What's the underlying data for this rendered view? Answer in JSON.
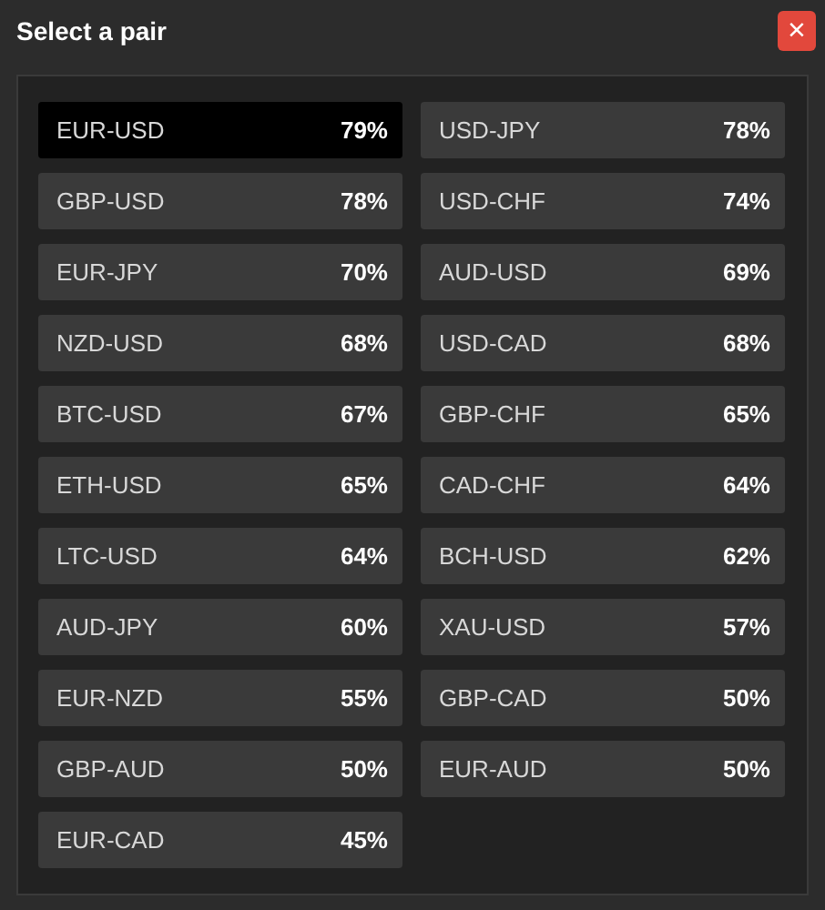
{
  "dialog": {
    "title": "Select a pair",
    "close": "×"
  },
  "pairs": [
    {
      "name": "EUR-USD",
      "payout": "79%",
      "selected": true
    },
    {
      "name": "USD-JPY",
      "payout": "78%",
      "selected": false
    },
    {
      "name": "GBP-USD",
      "payout": "78%",
      "selected": false
    },
    {
      "name": "USD-CHF",
      "payout": "74%",
      "selected": false
    },
    {
      "name": "EUR-JPY",
      "payout": "70%",
      "selected": false
    },
    {
      "name": "AUD-USD",
      "payout": "69%",
      "selected": false
    },
    {
      "name": "NZD-USD",
      "payout": "68%",
      "selected": false
    },
    {
      "name": "USD-CAD",
      "payout": "68%",
      "selected": false
    },
    {
      "name": "BTC-USD",
      "payout": "67%",
      "selected": false
    },
    {
      "name": "GBP-CHF",
      "payout": "65%",
      "selected": false
    },
    {
      "name": "ETH-USD",
      "payout": "65%",
      "selected": false
    },
    {
      "name": "CAD-CHF",
      "payout": "64%",
      "selected": false
    },
    {
      "name": "LTC-USD",
      "payout": "64%",
      "selected": false
    },
    {
      "name": "BCH-USD",
      "payout": "62%",
      "selected": false
    },
    {
      "name": "AUD-JPY",
      "payout": "60%",
      "selected": false
    },
    {
      "name": "XAU-USD",
      "payout": "57%",
      "selected": false
    },
    {
      "name": "EUR-NZD",
      "payout": "55%",
      "selected": false
    },
    {
      "name": "GBP-CAD",
      "payout": "50%",
      "selected": false
    },
    {
      "name": "GBP-AUD",
      "payout": "50%",
      "selected": false
    },
    {
      "name": "EUR-AUD",
      "payout": "50%",
      "selected": false
    },
    {
      "name": "EUR-CAD",
      "payout": "45%",
      "selected": false
    }
  ]
}
